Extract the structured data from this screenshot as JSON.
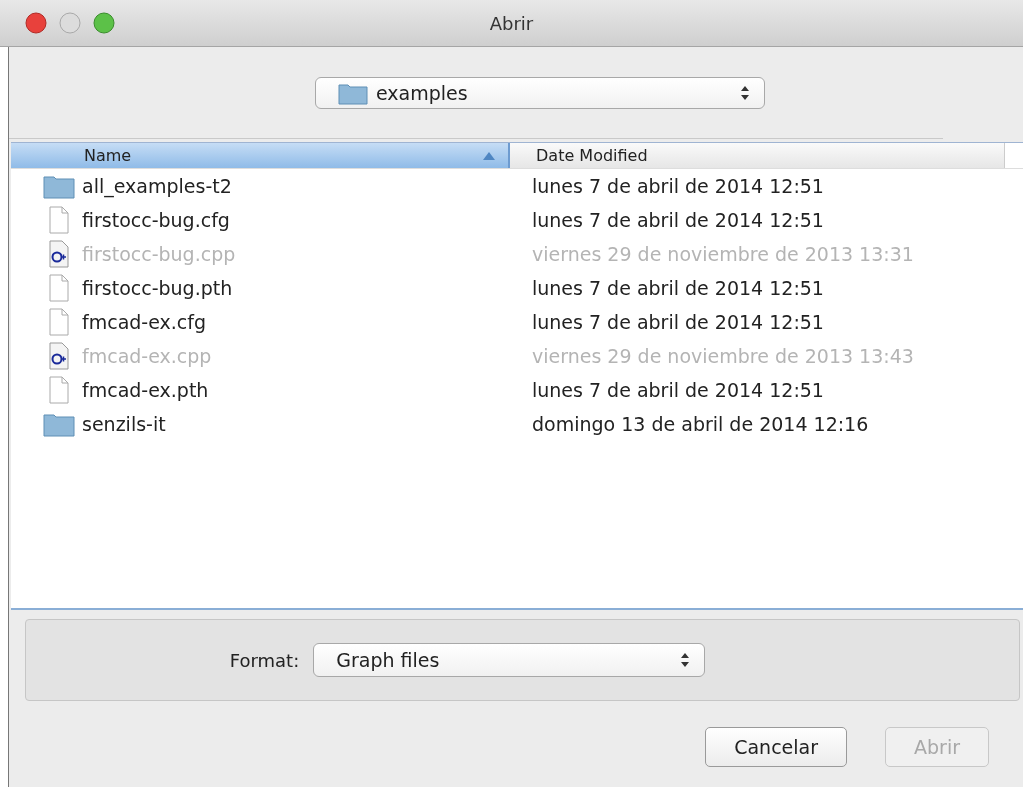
{
  "window": {
    "title": "Abrir"
  },
  "location": {
    "value": "examples"
  },
  "table": {
    "columns": [
      {
        "label": "Name",
        "selected": true
      },
      {
        "label": "Date Modified",
        "selected": false
      }
    ],
    "rows": [
      {
        "kind": "folder",
        "name": "all_examples-t2",
        "date": "lunes 7 de abril de 2014 12:51",
        "disabled": false
      },
      {
        "kind": "file",
        "name": "firstocc-bug.cfg",
        "date": "lunes 7 de abril de 2014 12:51",
        "disabled": false
      },
      {
        "kind": "cpp",
        "name": "firstocc-bug.cpp",
        "date": "viernes 29 de noviembre de 2013 13:31",
        "disabled": true
      },
      {
        "kind": "file",
        "name": "firstocc-bug.pth",
        "date": "lunes 7 de abril de 2014 12:51",
        "disabled": false
      },
      {
        "kind": "file",
        "name": "fmcad-ex.cfg",
        "date": "lunes 7 de abril de 2014 12:51",
        "disabled": false
      },
      {
        "kind": "cpp",
        "name": "fmcad-ex.cpp",
        "date": "viernes 29 de noviembre de 2013 13:43",
        "disabled": true
      },
      {
        "kind": "file",
        "name": "fmcad-ex.pth",
        "date": "lunes 7 de abril de 2014 12:51",
        "disabled": false
      },
      {
        "kind": "folder",
        "name": "senzils-it",
        "date": "domingo 13 de abril de 2014 12:16",
        "disabled": false
      }
    ]
  },
  "format": {
    "label": "Format:",
    "value": "Graph files"
  },
  "buttons": [
    {
      "label": "Cancelar",
      "disabled": false
    },
    {
      "label": "Abrir",
      "disabled": true
    }
  ]
}
